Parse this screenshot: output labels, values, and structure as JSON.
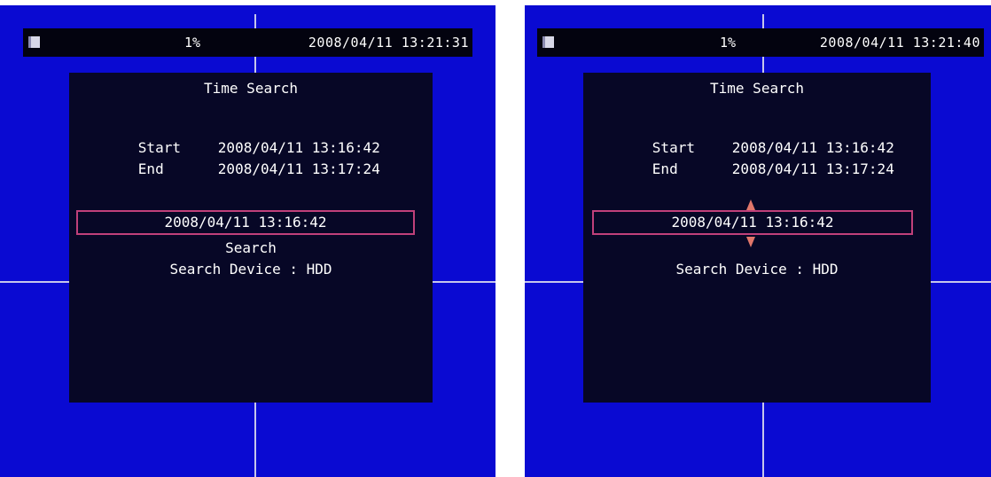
{
  "screens": [
    {
      "status": {
        "usage": "1%",
        "clock": "2008/04/11 13:21:31"
      },
      "dialog": {
        "title": "Time Search",
        "start_label": "Start",
        "start_value": "2008/04/11 13:16:42",
        "end_label": "End",
        "end_value": "2008/04/11 13:17:24",
        "input_value": "2008/04/11 13:16:42",
        "search_label": "Search",
        "device": "Search Device : HDD"
      }
    },
    {
      "status": {
        "usage": "1%",
        "clock": "2008/04/11 13:21:40"
      },
      "dialog": {
        "title": "Time Search",
        "start_label": "Start",
        "start_value": "2008/04/11 13:16:42",
        "end_label": "End",
        "end_value": "2008/04/11 13:17:24",
        "input_value": "2008/04/11 13:16:42",
        "device": "Search Device : HDD"
      }
    }
  ],
  "colors": {
    "background": "#0a0ad2",
    "panel": "#070726",
    "highlight": "#c0407a",
    "arrows": "#e0766a"
  },
  "icons": {
    "status": "hdd-icon",
    "spinner": "up-down-arrows-icon"
  }
}
